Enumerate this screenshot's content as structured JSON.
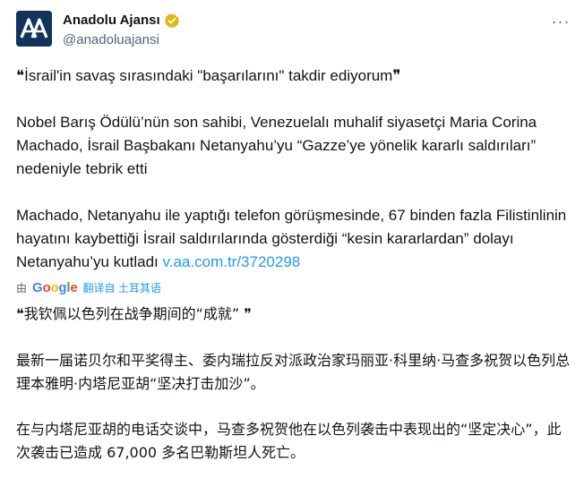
{
  "account": {
    "display_name": "Anadolu Ajansı",
    "handle": "@anadoluajansi",
    "avatar_text": "AA",
    "more_label": "···"
  },
  "tweet": {
    "p1": "❝İsrail'in savaş sırasındaki \"başarılarını\" takdir ediyorum❞",
    "p2": "Nobel Barış Ödülü’nün son sahibi, Venezuelalı muhalif siyasetçi Maria Corina Machado, İsrail Başbakanı Netanyahu’yu “Gazze’ye yönelik kararlı saldırıları” nedeniyle tebrik etti",
    "p3_text": "Machado, Netanyahu ile yaptığı telefon görüşmesinde, 67 binden fazla Filistinlinin hayatını kaybettiği İsrail saldırılarında gösterdiği “kesin kararlardan” dolayı Netanyahu’yu kutladı",
    "p3_link": "v.aa.com.tr/3720298"
  },
  "translation": {
    "by_label": "由",
    "google": [
      "G",
      "o",
      "o",
      "g",
      "l",
      "e"
    ],
    "action_label": "翻译自 土耳其语"
  },
  "translated": {
    "z1": "❝我钦佩以色列在战争期间的“成就” ❞",
    "z2": "最新一届诺贝尔和平奖得主、委内瑞拉反对派政治家玛丽亚·科里纳·马查多祝贺以色列总理本雅明·内塔尼亚胡“坚决打击加沙”。",
    "z3": "在与内塔尼亚胡的电话交谈中，马查多祝贺他在以色列袭击中表现出的“坚定决心”，此次袭击已造成 67,000 多名巴勒斯坦人死亡。"
  },
  "colors": {
    "text": "#0f1419",
    "secondary": "#536471",
    "link": "#1d9bf0",
    "verified_badge": "#e2b719",
    "avatar_bg": "#12345c"
  }
}
